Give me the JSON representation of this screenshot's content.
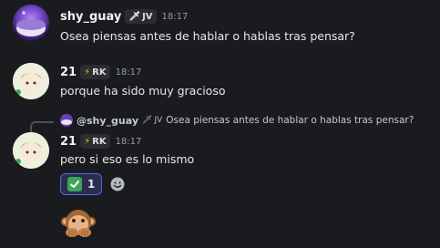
{
  "messages": [
    {
      "username": "shy_guay",
      "tag": "JV",
      "time": "18:17",
      "text": "Osea piensas antes de hablar o hablas tras pensar?"
    },
    {
      "username": "21",
      "tag": "RK",
      "time": "18:17",
      "text": "porque ha sido muy gracioso"
    },
    {
      "username": "21",
      "tag": "RK",
      "time": "18:17",
      "text": "pero si eso es lo mismo",
      "reply": {
        "username": "@shy_guay",
        "tag": "JV",
        "text": "Osea piensas antes de hablar o hablas tras pensar?"
      },
      "reactions": [
        {
          "emoji": "check-mark-button",
          "count": "1"
        }
      ]
    }
  ],
  "sticker": {
    "name": "monkey-covering-mouth"
  },
  "colors": {
    "background": "#1a1b1e",
    "reaction_border": "#5865f2",
    "check_green": "#3ba55c"
  }
}
